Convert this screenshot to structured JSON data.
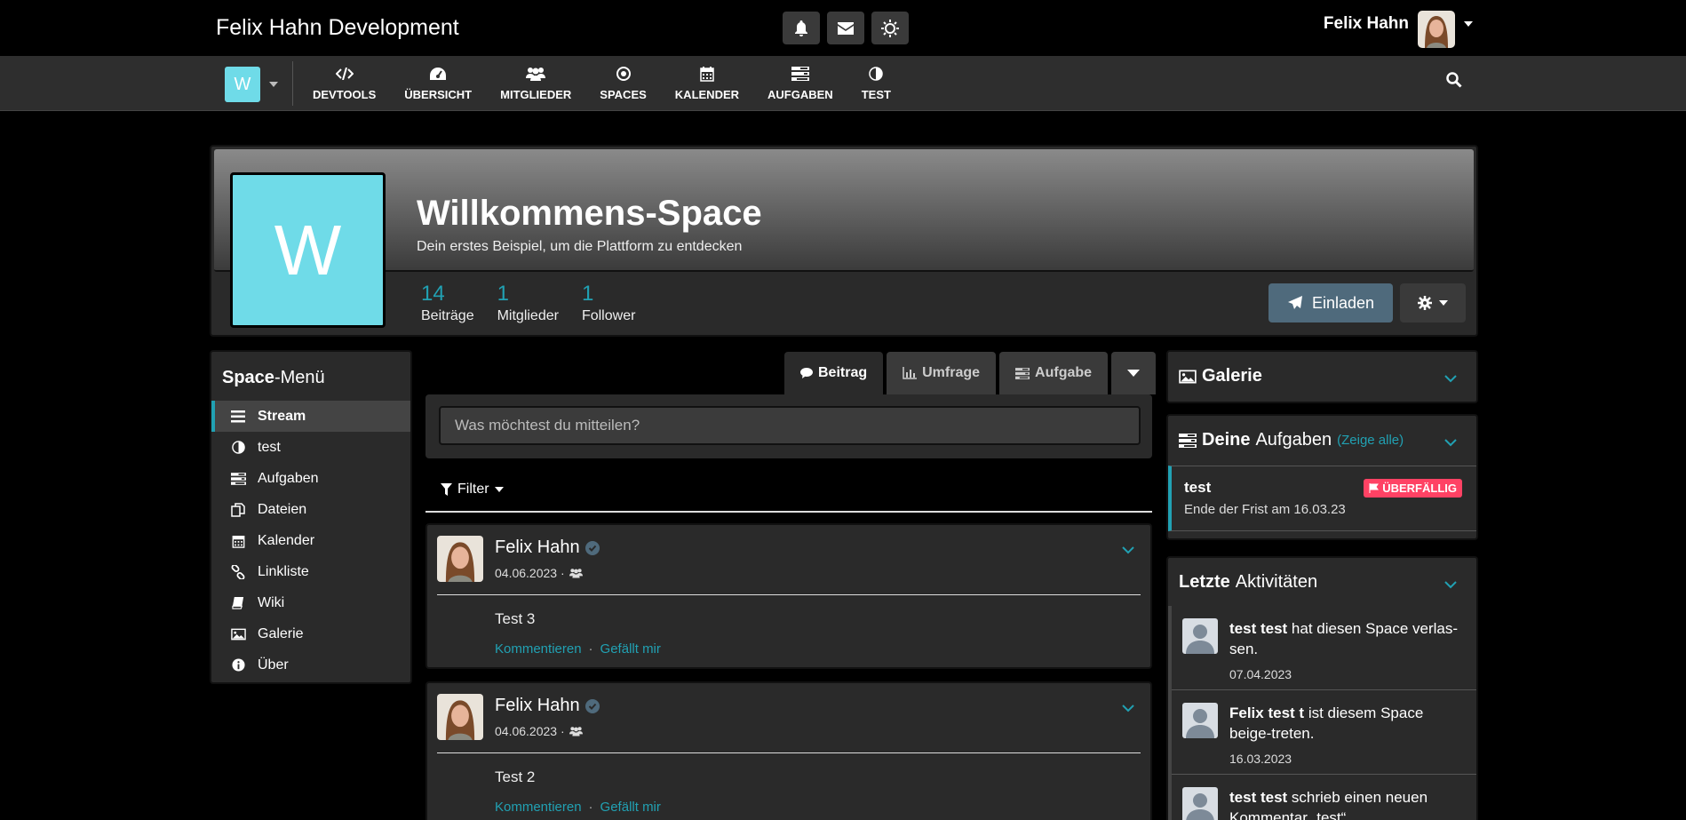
{
  "topbar": {
    "brand": "Felix Hahn Development",
    "user_name": "Felix Hahn"
  },
  "nav": {
    "space_letter": "W",
    "items": [
      {
        "label": "DEVTOOLS",
        "icon": "code-icon"
      },
      {
        "label": "ÜBERSICHT",
        "icon": "dashboard-icon"
      },
      {
        "label": "MITGLIEDER",
        "icon": "users-icon"
      },
      {
        "label": "SPACES",
        "icon": "dot-circle-icon"
      },
      {
        "label": "KALENDER",
        "icon": "calendar-icon"
      },
      {
        "label": "AUFGABEN",
        "icon": "tasks-icon"
      },
      {
        "label": "TEST",
        "icon": "adjust-icon"
      }
    ]
  },
  "header": {
    "logo_letter": "W",
    "title": "Willkommens-Space",
    "description": "Dein erstes Beispiel, um die Plattform zu entdecken",
    "stats": [
      {
        "num": "14",
        "label": "Beiträge"
      },
      {
        "num": "1",
        "label": "Mitglieder"
      },
      {
        "num": "1",
        "label": "Follower"
      }
    ],
    "invite_label": "Einladen"
  },
  "space_menu": {
    "title_bold": "Space",
    "title_rest": "-Menü",
    "items": [
      {
        "label": "Stream",
        "icon": "bars-icon"
      },
      {
        "label": "test",
        "icon": "adjust-icon"
      },
      {
        "label": "Aufgaben",
        "icon": "tasks-icon"
      },
      {
        "label": "Dateien",
        "icon": "files-icon"
      },
      {
        "label": "Kalender",
        "icon": "calendar-icon"
      },
      {
        "label": "Linkliste",
        "icon": "link-icon"
      },
      {
        "label": "Wiki",
        "icon": "book-icon"
      },
      {
        "label": "Galerie",
        "icon": "image-icon"
      },
      {
        "label": "Über",
        "icon": "info-icon"
      }
    ]
  },
  "composer": {
    "tabs": [
      "Beitrag",
      "Umfrage",
      "Aufgabe"
    ],
    "placeholder": "Was möchtest du mitteilen?",
    "filter_label": "Filter"
  },
  "posts": [
    {
      "author": "Felix Hahn",
      "date": "04.06.2023 ·",
      "body": "Test 3",
      "comment": "Kommentieren",
      "like": "Gefällt mir"
    },
    {
      "author": "Felix Hahn",
      "date": "04.06.2023 ·",
      "body": "Test 2",
      "comment": "Kommentieren",
      "like": "Gefällt mir"
    }
  ],
  "gallery": {
    "title": "Galerie"
  },
  "tasks": {
    "title_bold": "Deine",
    "title_rest": "Aufgaben",
    "link": "(Zeige alle)",
    "item_title": "test",
    "item_due": "Ende der Frist am 16.03.23",
    "badge": "ÜBERFÄLLIG"
  },
  "activities": {
    "title_bold": "Letzte",
    "title_rest": "Aktivitäten",
    "items": [
      {
        "name": "test test",
        "text": " hat diesen Space verlas-sen.",
        "date": "07.04.2023"
      },
      {
        "name": "Felix test t",
        "text": " ist diesem Space beige-treten.",
        "date": "16.03.2023"
      },
      {
        "name": "test test",
        "text": " schrieb einen neuen Kommentar „test“",
        "date": ""
      }
    ]
  },
  "colors": {
    "accent": "#21a1b3",
    "space": "#6fdbe8",
    "danger": "#ff4264",
    "invite": "#4f6a7c"
  }
}
